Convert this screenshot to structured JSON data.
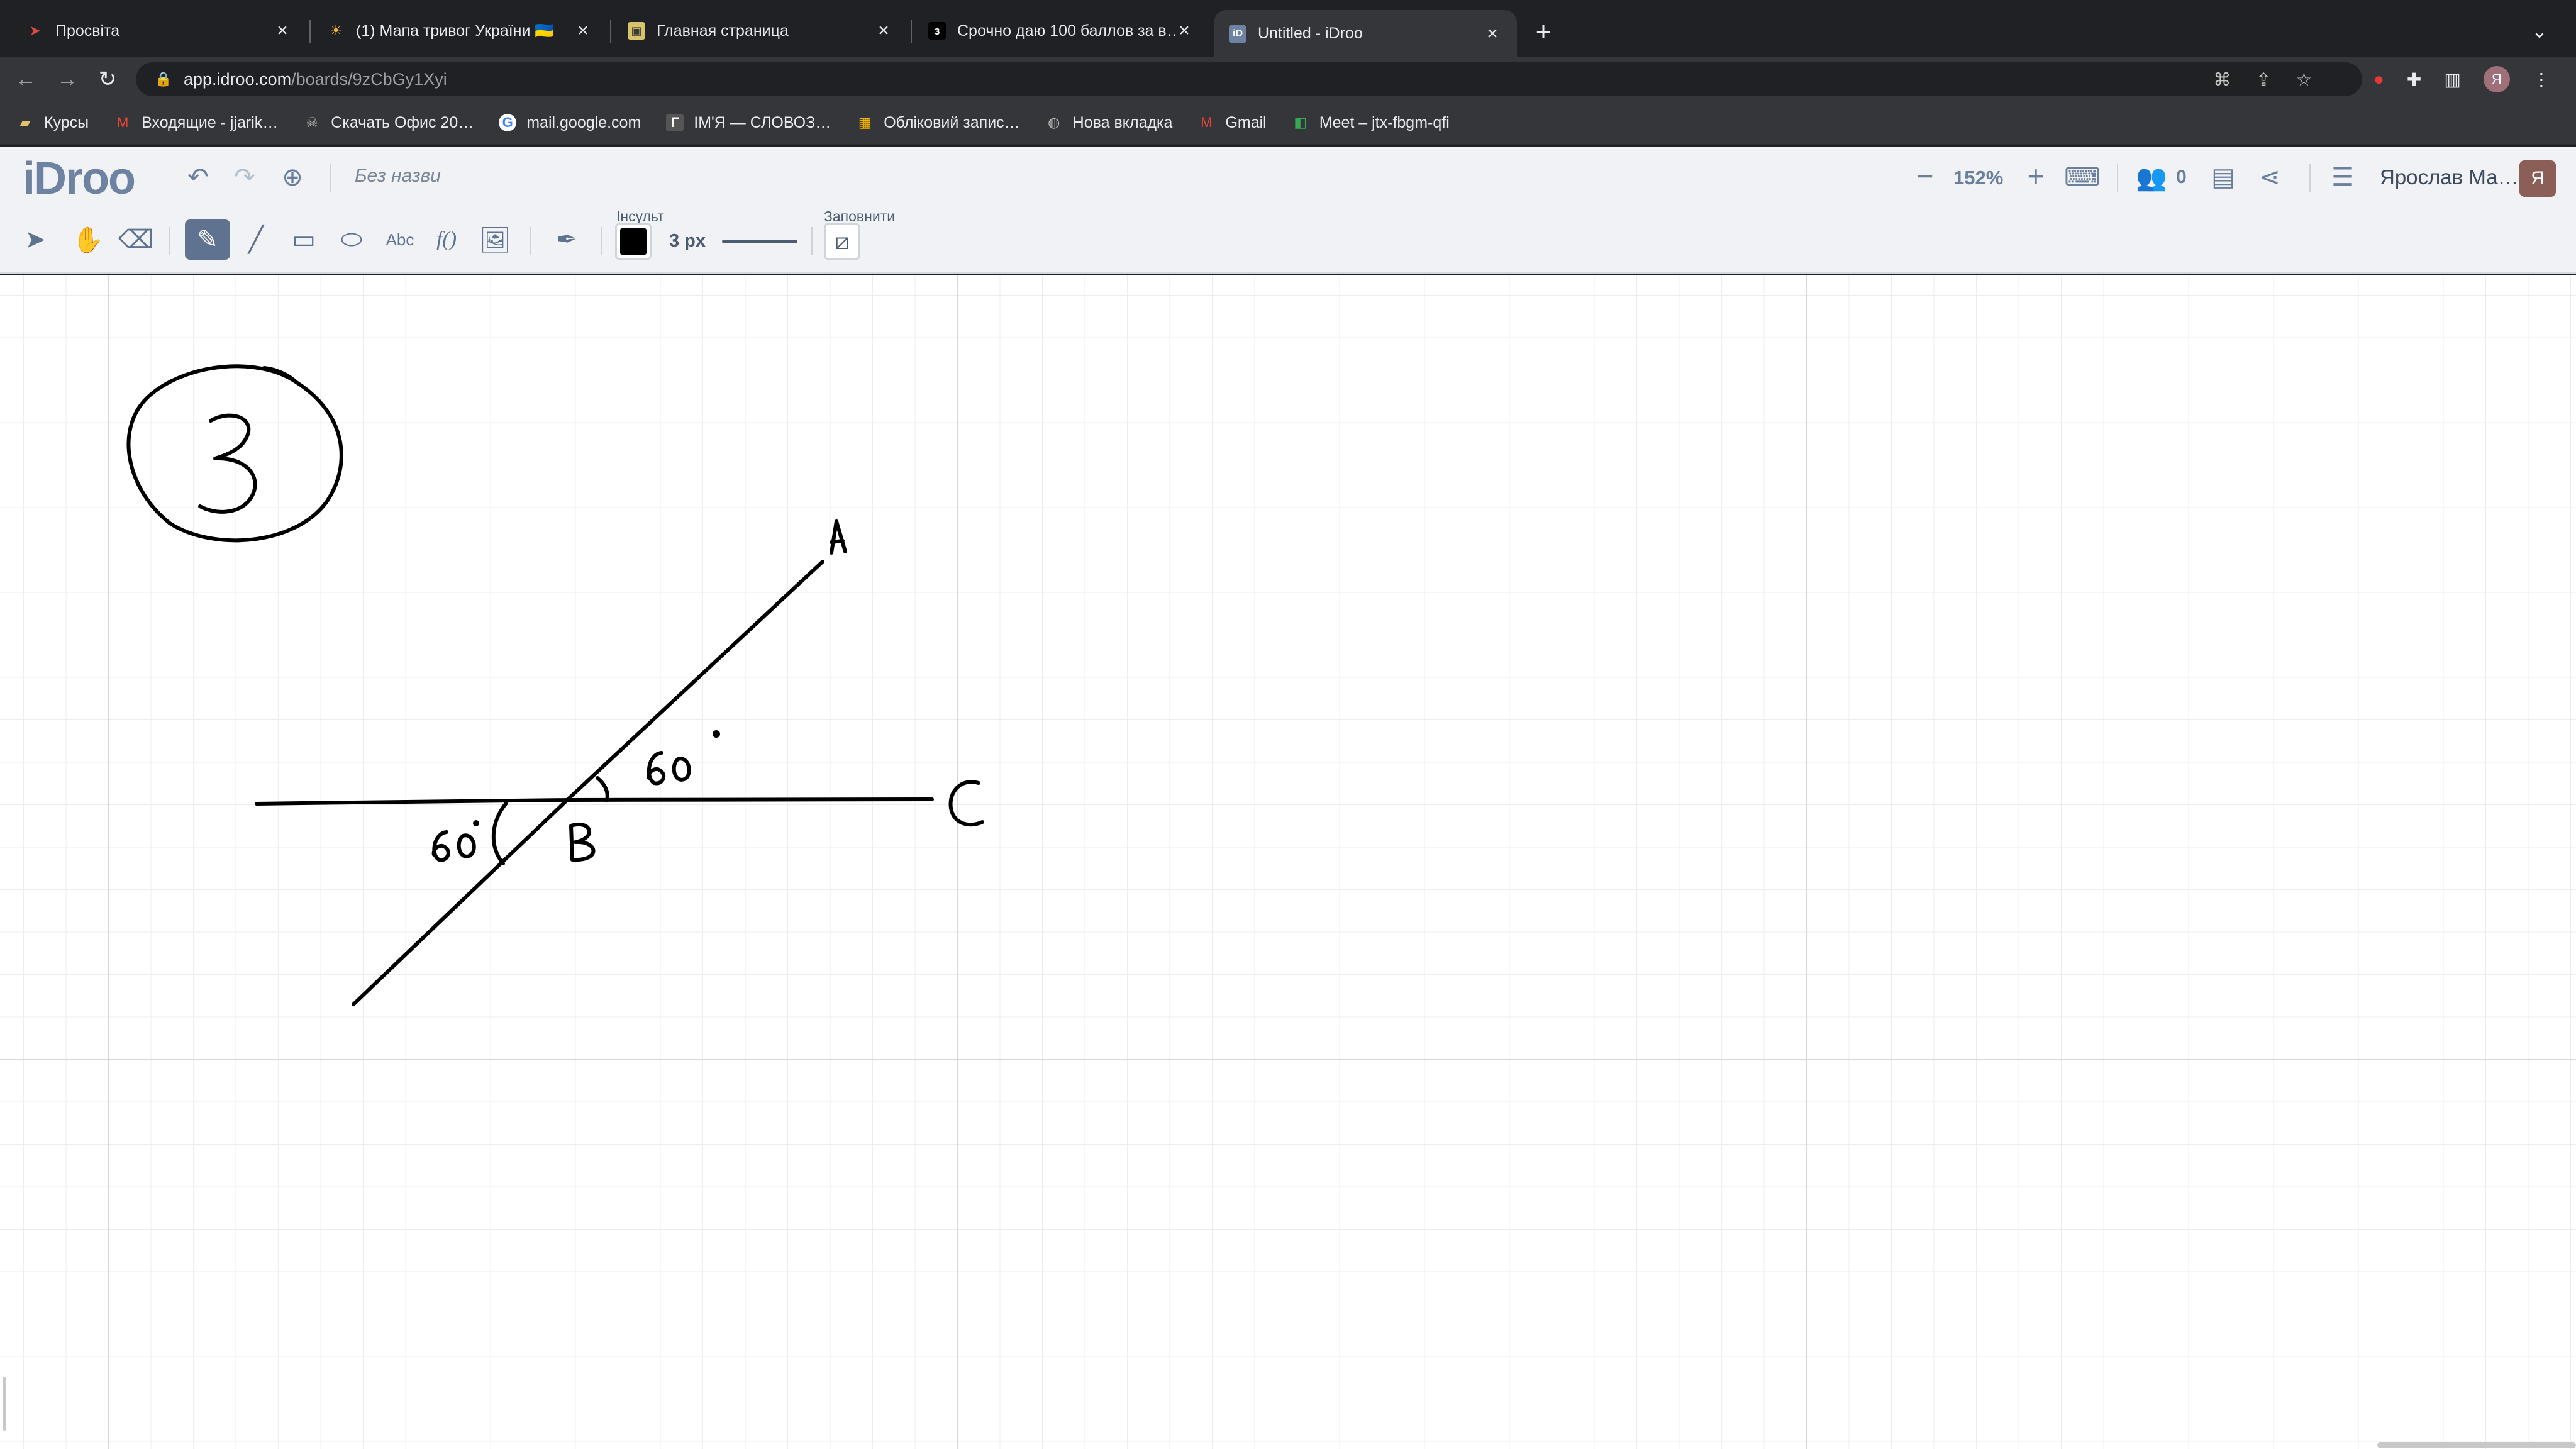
{
  "browser": {
    "tabs": [
      {
        "title": "Просвіта",
        "icon": "prosvita-icon"
      },
      {
        "title": "(1) Мапа тривог України 🇺🇦",
        "icon": "alert-map-icon"
      },
      {
        "title": "Главная страница",
        "icon": "home-page-icon"
      },
      {
        "title": "Срочно даю 100 баллов за в…",
        "icon": "znanija-icon"
      },
      {
        "title": "Untitled - iDroo",
        "icon": "idroo-icon",
        "active": true
      }
    ],
    "url_host": "app.idroo.com",
    "url_path": "/boards/9zCbGy1Xyi",
    "profile_initial": "Я",
    "bookmarks": [
      {
        "label": "Курсы",
        "icon": "folder-icon"
      },
      {
        "label": "Входящие - jjarik…",
        "icon": "gmail-icon"
      },
      {
        "label": "Скачать Офис 20…",
        "icon": "download-site-icon"
      },
      {
        "label": "mail.google.com",
        "icon": "google-icon"
      },
      {
        "label": "ІМ'Я — СЛОВОЗ…",
        "icon": "slovozbir-icon"
      },
      {
        "label": "Обліковий запис…",
        "icon": "microsoft-icon"
      },
      {
        "label": "Нова вкладка",
        "icon": "globe-icon"
      },
      {
        "label": "Gmail",
        "icon": "gmail-icon"
      },
      {
        "label": "Meet – jtx-fbgm-qfi",
        "icon": "meet-icon"
      }
    ]
  },
  "app": {
    "logo": "iDroo",
    "board_name": "Без назви",
    "zoom": "152%",
    "users_count": "0",
    "user_name": "Ярослав Ма…",
    "user_initial": "Я",
    "stroke_label": "Інсульт",
    "stroke_width": "3 px",
    "stroke_color": "#000000",
    "fill_label": "Заповнити",
    "text_tool_label": "Abc",
    "formula_tool_label": "f()",
    "accent": "#5f7391"
  }
}
